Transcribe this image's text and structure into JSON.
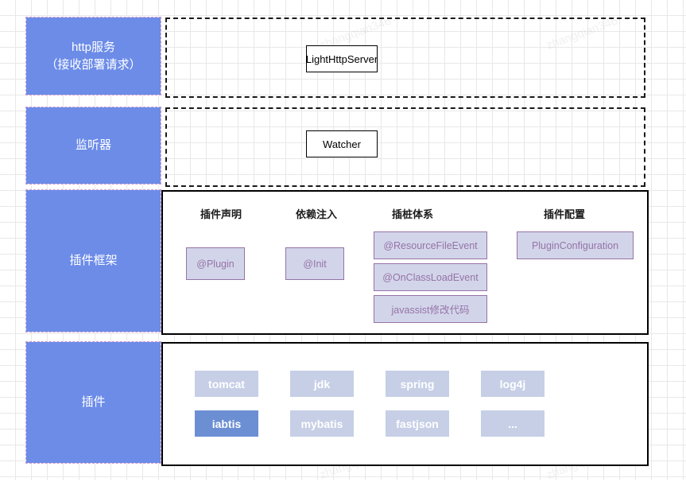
{
  "diagram": {
    "watermark_text": "zhangqian346",
    "colors": {
      "label_blue": "#6c8ce8",
      "chip_light": "#c6cfe6",
      "chip_highlight": "#6c8fd4",
      "purple_fill": "#d2d5ea",
      "purple_border": "#9673a6",
      "grid": "#e8e8e8"
    },
    "rows": [
      {
        "label": "http服务\n（接收部署请求）",
        "label_line1": "http服务",
        "label_line2": "（接收部署请求）",
        "container_style": "dashed",
        "nodes": [
          {
            "text": "LightHttpServer"
          }
        ]
      },
      {
        "label_line1": "监听器",
        "label_line2": "",
        "container_style": "dashed",
        "nodes": [
          {
            "text": "Watcher"
          }
        ]
      },
      {
        "label_line1": "插件框架",
        "label_line2": "",
        "container_style": "solid",
        "columns": [
          {
            "title": "插件声明",
            "items": [
              "@Plugin"
            ]
          },
          {
            "title": "依赖注入",
            "items": [
              "@Init"
            ]
          },
          {
            "title": "插桩体系",
            "items": [
              "@ResourceFileEvent",
              "@OnClassLoadEvent",
              "javassist修改代码"
            ]
          },
          {
            "title": "插件配置",
            "items": [
              "PluginConfiguration"
            ]
          }
        ]
      },
      {
        "label_line1": "插件",
        "label_line2": "",
        "container_style": "solid",
        "chips": [
          {
            "text": "tomcat",
            "highlight": false
          },
          {
            "text": "jdk",
            "highlight": false
          },
          {
            "text": "spring",
            "highlight": false
          },
          {
            "text": "log4j",
            "highlight": false
          },
          {
            "text": "iabtis",
            "highlight": true
          },
          {
            "text": "mybatis",
            "highlight": false
          },
          {
            "text": "fastjson",
            "highlight": false
          },
          {
            "text": "...",
            "highlight": false
          }
        ]
      }
    ]
  }
}
